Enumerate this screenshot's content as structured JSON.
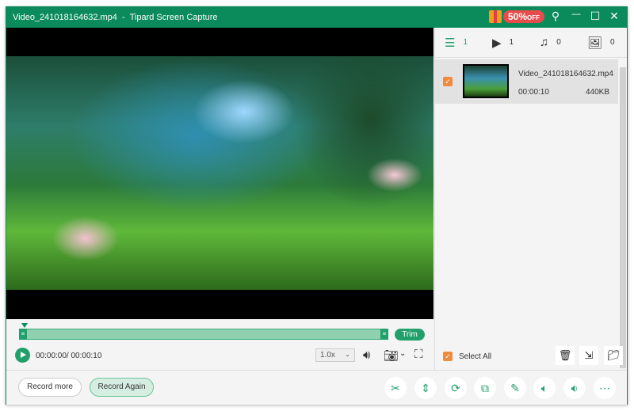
{
  "title": "Video_241018164632.mp4  -  Tipard Screen Capture",
  "promo": {
    "percent": "50%",
    "off": "OFF"
  },
  "window_controls": {
    "pin": "⚲",
    "minimize": "—",
    "maximize": "☐",
    "close": "✕"
  },
  "player": {
    "time": "00:00:00/ 00:00:10",
    "speed": "1.0x",
    "trim_label": "Trim",
    "progress": 0
  },
  "tabs": [
    {
      "icon": "list-icon",
      "count": "1"
    },
    {
      "icon": "video-icon",
      "count": "1"
    },
    {
      "icon": "music-icon",
      "count": "0"
    },
    {
      "icon": "image-icon",
      "count": "0"
    }
  ],
  "files": [
    {
      "name": "Video_241018164632.mp4",
      "duration": "00:00:10",
      "size": "440KB",
      "checked": true
    }
  ],
  "select_all_label": "Select All",
  "buttons": {
    "record_more": "Record more",
    "record_again": "Record Again"
  },
  "accent": "#0b8a5c"
}
